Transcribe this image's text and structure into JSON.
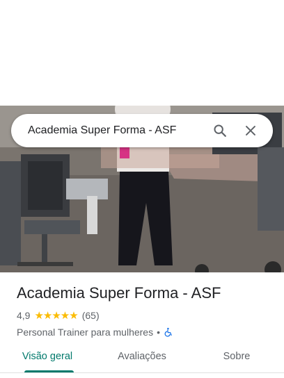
{
  "search": {
    "query": "Academia Super Forma - ASF"
  },
  "place": {
    "name": "Academia Super Forma - ASF",
    "rating": "4,9",
    "stars": "★★★★★",
    "review_count": "(65)",
    "category": "Personal Trainer para mulheres",
    "separator": "•"
  },
  "tabs": [
    {
      "label": "Visão geral",
      "active": true
    },
    {
      "label": "Avaliações",
      "active": false
    },
    {
      "label": "Sobre",
      "active": false
    }
  ],
  "colors": {
    "accent": "#00796b",
    "star": "#fbbc04",
    "accessibility": "#1a73e8"
  },
  "icons": {
    "search": "search-icon",
    "close": "close-icon",
    "accessibility": "wheelchair-accessible-icon"
  }
}
